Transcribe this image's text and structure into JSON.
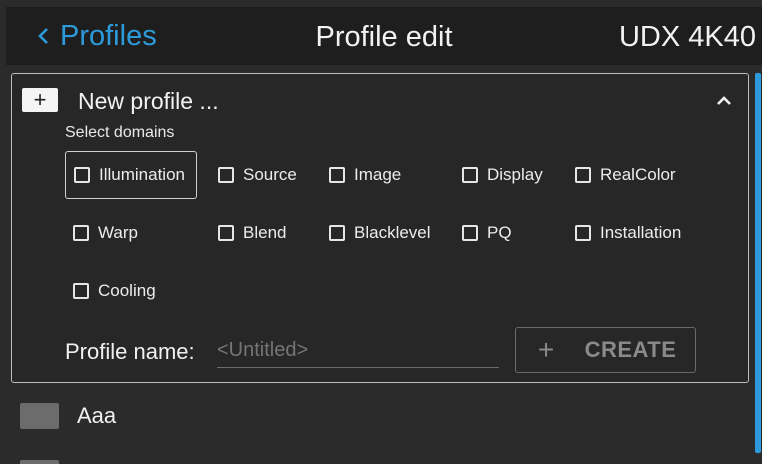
{
  "header": {
    "back_label": "Profiles",
    "title": "Profile edit",
    "device": "UDX 4K40"
  },
  "panel": {
    "plus_symbol": "+",
    "new_profile_label": "New profile ...",
    "select_domains_label": "Select domains",
    "domains": [
      {
        "label": "Illumination",
        "checked": false,
        "focused": true
      },
      {
        "label": "Source",
        "checked": false
      },
      {
        "label": "Image",
        "checked": false
      },
      {
        "label": "Display",
        "checked": false
      },
      {
        "label": "RealColor",
        "checked": false
      },
      {
        "label": "Warp",
        "checked": false
      },
      {
        "label": "Blend",
        "checked": false
      },
      {
        "label": "Blacklevel",
        "checked": false
      },
      {
        "label": "PQ",
        "checked": false
      },
      {
        "label": "Installation",
        "checked": false
      },
      {
        "label": "Cooling",
        "checked": false
      }
    ],
    "profile_name_label": "Profile name:",
    "profile_name_placeholder": "<Untitled>",
    "profile_name_value": "",
    "create_plus": "+",
    "create_label": "CREATE"
  },
  "profiles": [
    {
      "name": "Aaa"
    }
  ],
  "colors": {
    "accent": "#2d9bdb",
    "background": "#2b2b2b",
    "header_bg": "#1e1e1e"
  }
}
